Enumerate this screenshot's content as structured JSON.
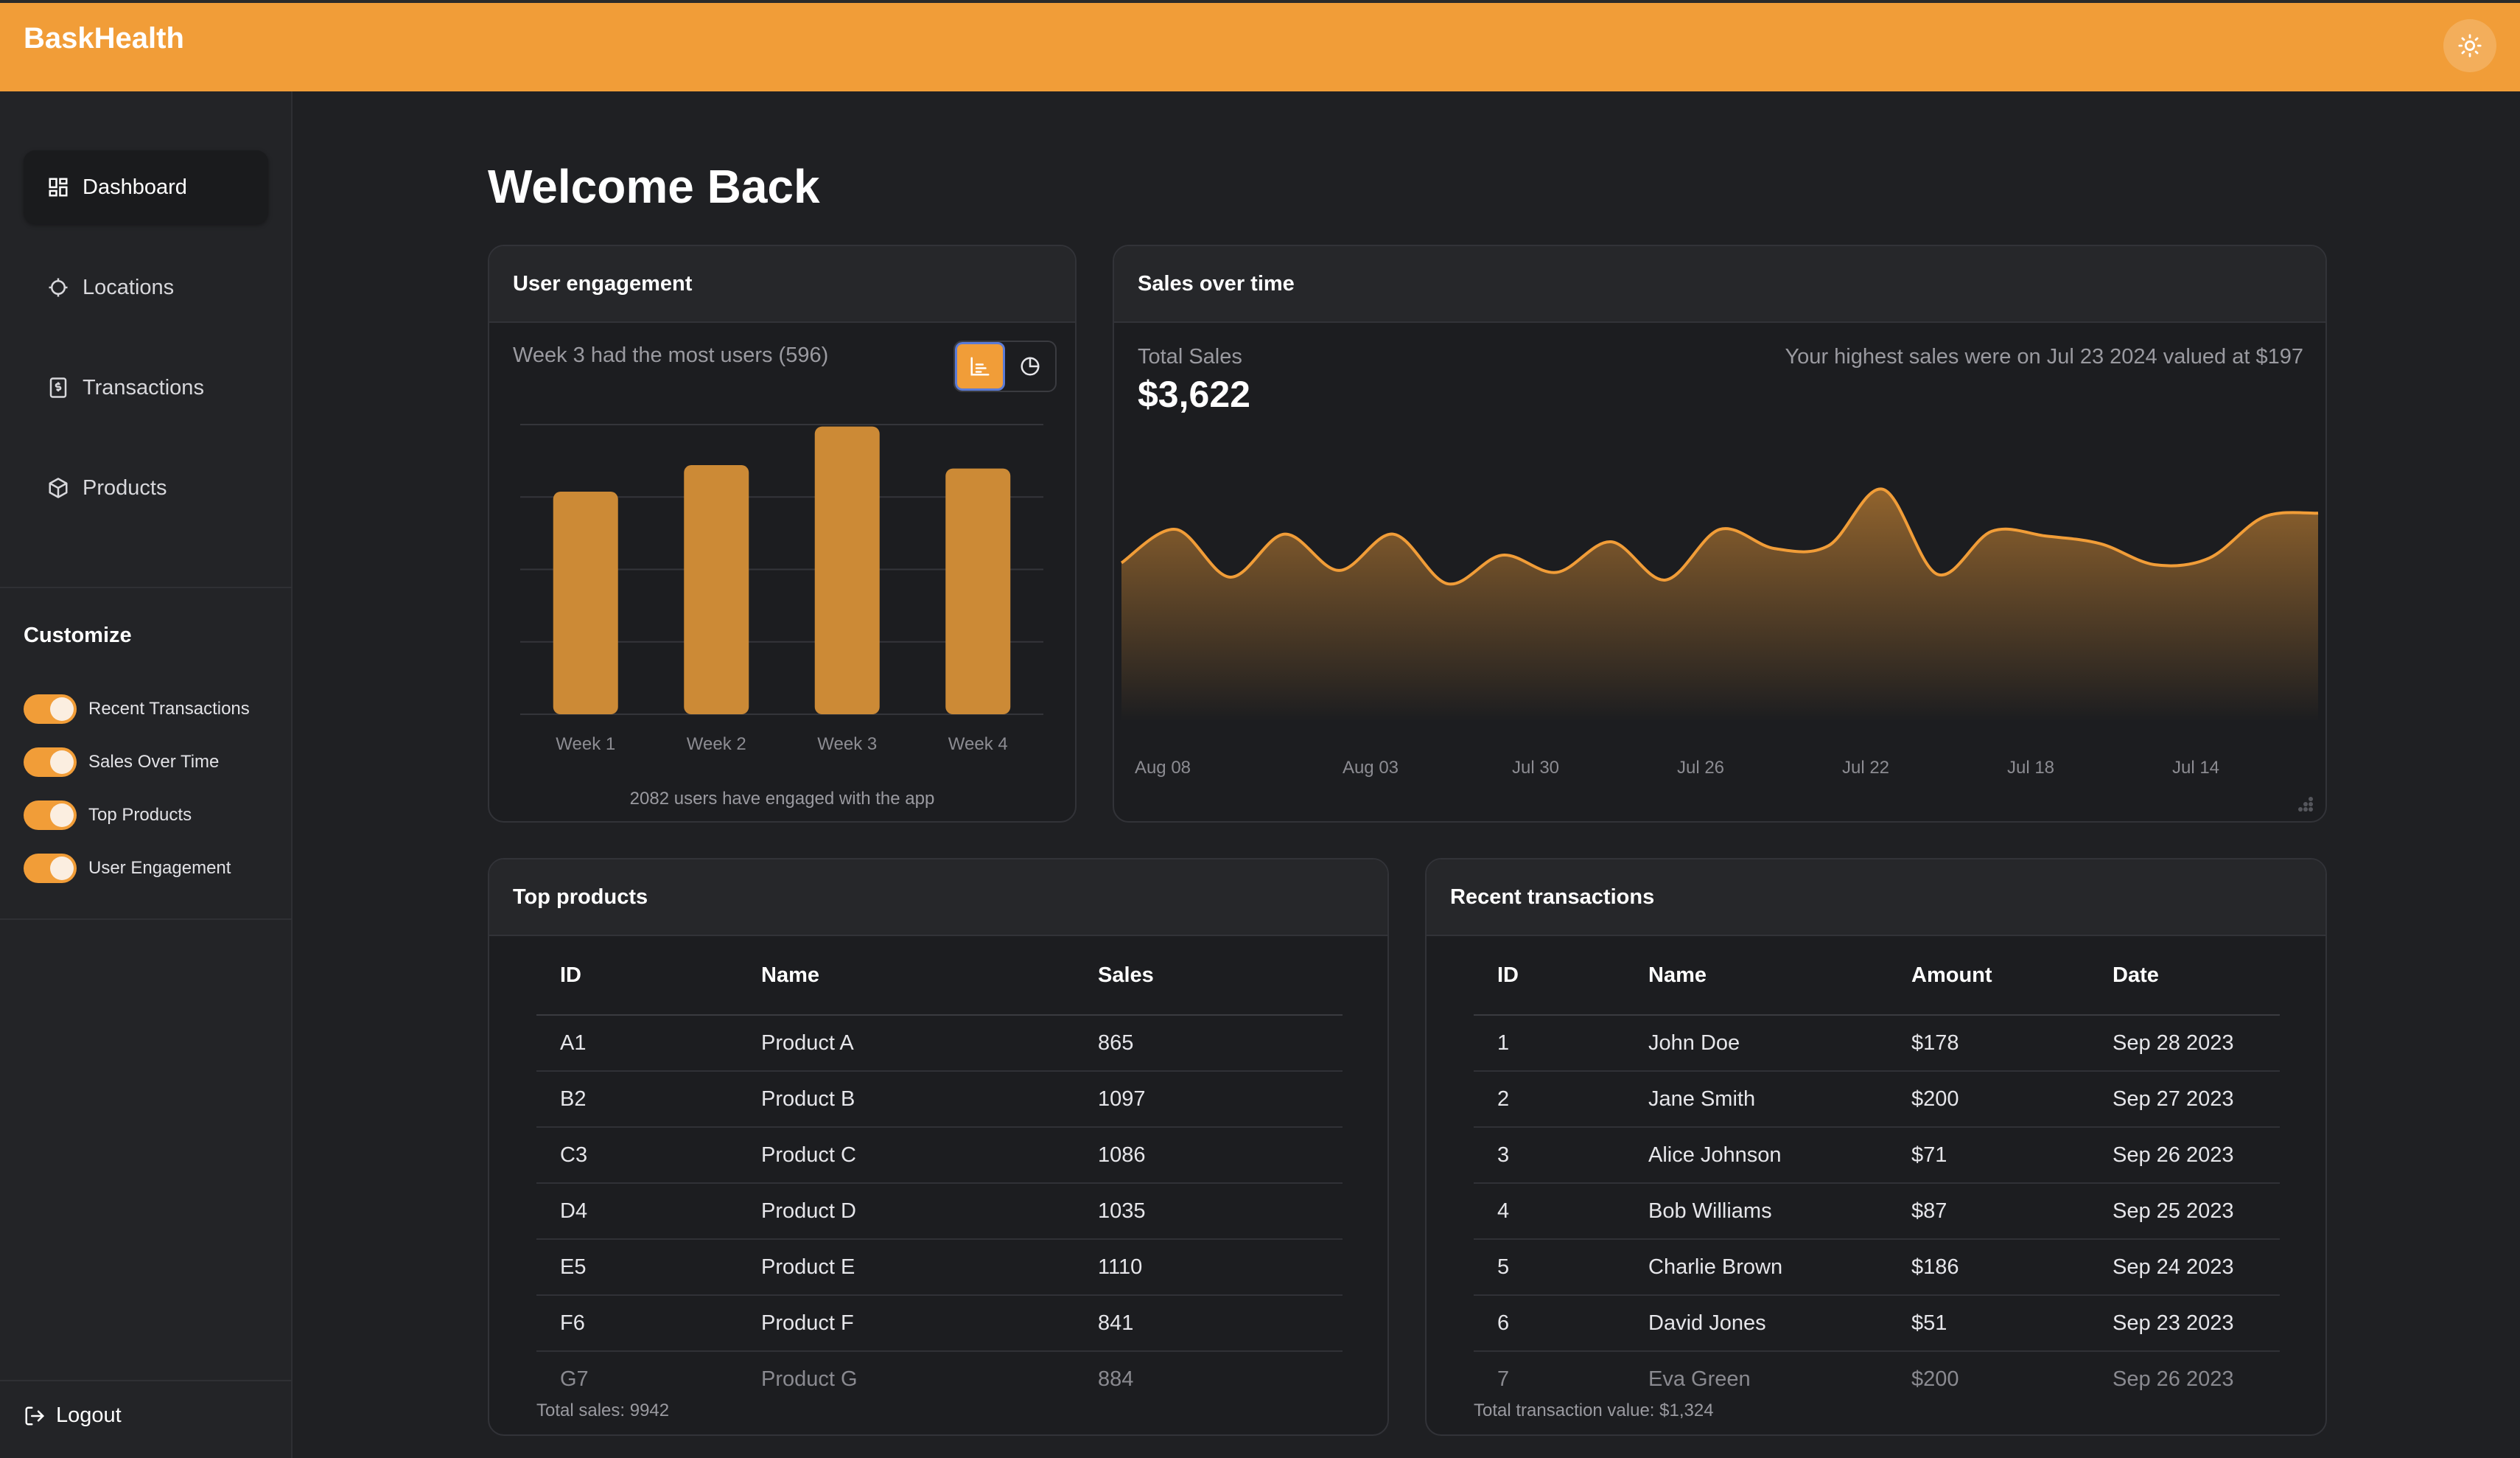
{
  "app": {
    "title": "BaskHealth"
  },
  "sidebar": {
    "items": [
      {
        "label": "Dashboard",
        "icon": "dashboard-icon"
      },
      {
        "label": "Locations",
        "icon": "crosshair-icon"
      },
      {
        "label": "Transactions",
        "icon": "receipt-icon"
      },
      {
        "label": "Products",
        "icon": "package-icon"
      }
    ],
    "customize": {
      "title": "Customize",
      "toggles": [
        {
          "label": "Recent Transactions",
          "on": true
        },
        {
          "label": "Sales Over Time",
          "on": true
        },
        {
          "label": "Top Products",
          "on": true
        },
        {
          "label": "User Engagement",
          "on": true
        }
      ]
    },
    "logout_label": "Logout"
  },
  "page": {
    "title": "Welcome Back"
  },
  "engagement": {
    "title": "User engagement",
    "summary": "Week 3 had the most users (596)",
    "footer": "2082 users have engaged with the app"
  },
  "sales": {
    "title": "Sales over time",
    "total_label": "Total Sales",
    "total_value": "$3,622",
    "highlight": "Your highest sales were on Jul 23 2024 valued at $197"
  },
  "top_products": {
    "title": "Top products",
    "columns": [
      "ID",
      "Name",
      "Sales"
    ],
    "rows": [
      [
        "A1",
        "Product A",
        "865"
      ],
      [
        "B2",
        "Product B",
        "1097"
      ],
      [
        "C3",
        "Product C",
        "1086"
      ],
      [
        "D4",
        "Product D",
        "1035"
      ],
      [
        "E5",
        "Product E",
        "1110"
      ],
      [
        "F6",
        "Product F",
        "841"
      ],
      [
        "G7",
        "Product G",
        "884"
      ]
    ],
    "footer": "Total sales: 9942"
  },
  "transactions": {
    "title": "Recent transactions",
    "columns": [
      "ID",
      "Name",
      "Amount",
      "Date"
    ],
    "rows": [
      [
        "1",
        "John Doe",
        "$178",
        "Sep 28 2023"
      ],
      [
        "2",
        "Jane Smith",
        "$200",
        "Sep 27 2023"
      ],
      [
        "3",
        "Alice Johnson",
        "$71",
        "Sep 26 2023"
      ],
      [
        "4",
        "Bob Williams",
        "$87",
        "Sep 25 2023"
      ],
      [
        "5",
        "Charlie Brown",
        "$186",
        "Sep 24 2023"
      ],
      [
        "6",
        "David Jones",
        "$51",
        "Sep 23 2023"
      ],
      [
        "7",
        "Eva Green",
        "$200",
        "Sep 26 2023"
      ]
    ],
    "footer": "Total transaction value: $1,324"
  },
  "colors": {
    "accent": "#f19d38",
    "background": "#1f2023",
    "card": "#1c1d20"
  },
  "chart_data": [
    {
      "type": "bar",
      "categories": [
        "Week 1",
        "Week 2",
        "Week 3",
        "Week 4"
      ],
      "values": [
        461,
        516,
        596,
        509
      ],
      "ylim": [
        0,
        600
      ],
      "grid": true
    },
    {
      "type": "area",
      "x_ticks": [
        "Aug 08",
        "Aug 03",
        "Jul 30",
        "Jul 26",
        "Jul 22",
        "Jul 18",
        "Jul 14"
      ],
      "values": [
        120,
        155,
        105,
        150,
        112,
        150,
        98,
        128,
        110,
        142,
        102,
        155,
        135,
        138,
        197,
        108,
        153,
        148,
        140,
        118,
        125,
        168,
        172
      ],
      "ylim": [
        0,
        220
      ],
      "grid": false
    }
  ]
}
